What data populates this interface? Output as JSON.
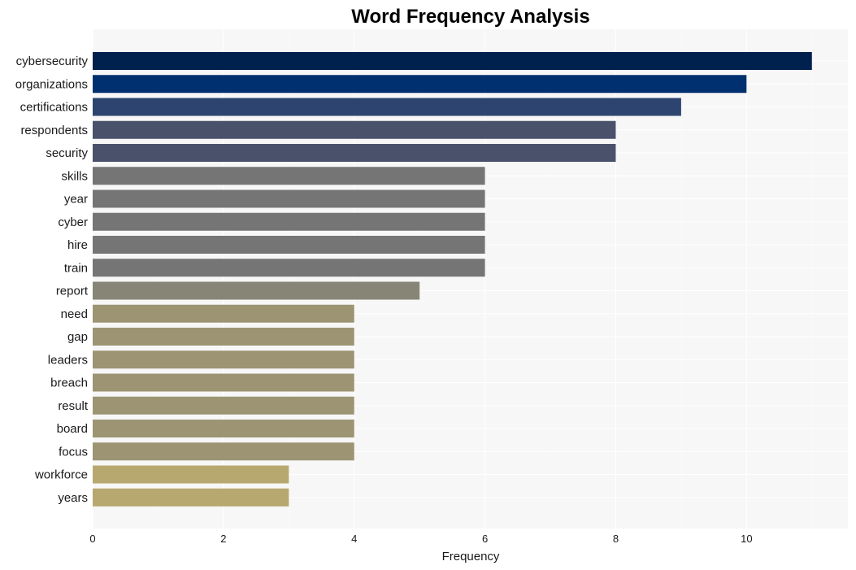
{
  "chart_data": {
    "type": "bar",
    "orientation": "horizontal",
    "title": "Word Frequency Analysis",
    "xlabel": "Frequency",
    "ylabel": "",
    "xlim": [
      0,
      11.55
    ],
    "xticks": [
      0,
      2,
      4,
      6,
      8,
      10
    ],
    "grid": true,
    "legend": "none",
    "categories": [
      "cybersecurity",
      "organizations",
      "certifications",
      "respondents",
      "security",
      "skills",
      "year",
      "cyber",
      "hire",
      "train",
      "report",
      "need",
      "gap",
      "leaders",
      "breach",
      "result",
      "board",
      "focus",
      "workforce",
      "years"
    ],
    "values": [
      11,
      10,
      9,
      8,
      8,
      6,
      6,
      6,
      6,
      6,
      5,
      4,
      4,
      4,
      4,
      4,
      4,
      4,
      3,
      3
    ],
    "colors": [
      "#00204e",
      "#00306f",
      "#2e4470",
      "#4a526b",
      "#4a526b",
      "#757576",
      "#757576",
      "#757576",
      "#757576",
      "#757576",
      "#878575",
      "#9d9473",
      "#9d9473",
      "#9d9473",
      "#9d9473",
      "#9d9473",
      "#9d9473",
      "#9d9473",
      "#b7a86f",
      "#b7a86f"
    ],
    "background": "#f7f7f7"
  }
}
